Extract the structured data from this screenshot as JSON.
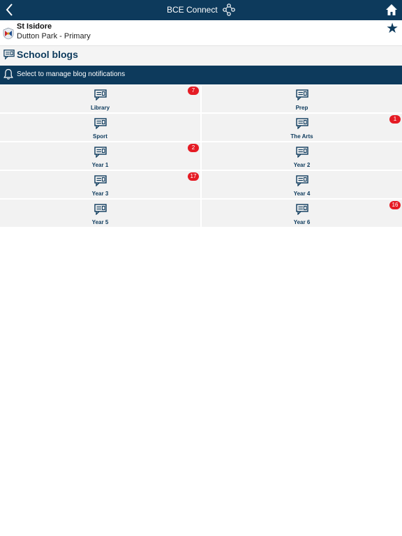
{
  "nav": {
    "title": "BCE Connect"
  },
  "school": {
    "name": "St Isidore",
    "subtitle": "Dutton Park - Primary"
  },
  "section": {
    "title": "School blogs"
  },
  "notifications": {
    "label": "Select to manage blog notifications"
  },
  "blogs": [
    {
      "label": "Library",
      "badge": "7"
    },
    {
      "label": "Prep",
      "badge": ""
    },
    {
      "label": "Sport",
      "badge": ""
    },
    {
      "label": "The Arts",
      "badge": "1"
    },
    {
      "label": "Year 1",
      "badge": "2"
    },
    {
      "label": "Year 2",
      "badge": ""
    },
    {
      "label": "Year 3",
      "badge": "17"
    },
    {
      "label": "Year 4",
      "badge": ""
    },
    {
      "label": "Year 5",
      "badge": ""
    },
    {
      "label": "Year 6",
      "badge": "16"
    }
  ],
  "colors": {
    "primary": "#0d3a5c",
    "badge": "#e51b24",
    "tile": "#f2f2f2"
  }
}
